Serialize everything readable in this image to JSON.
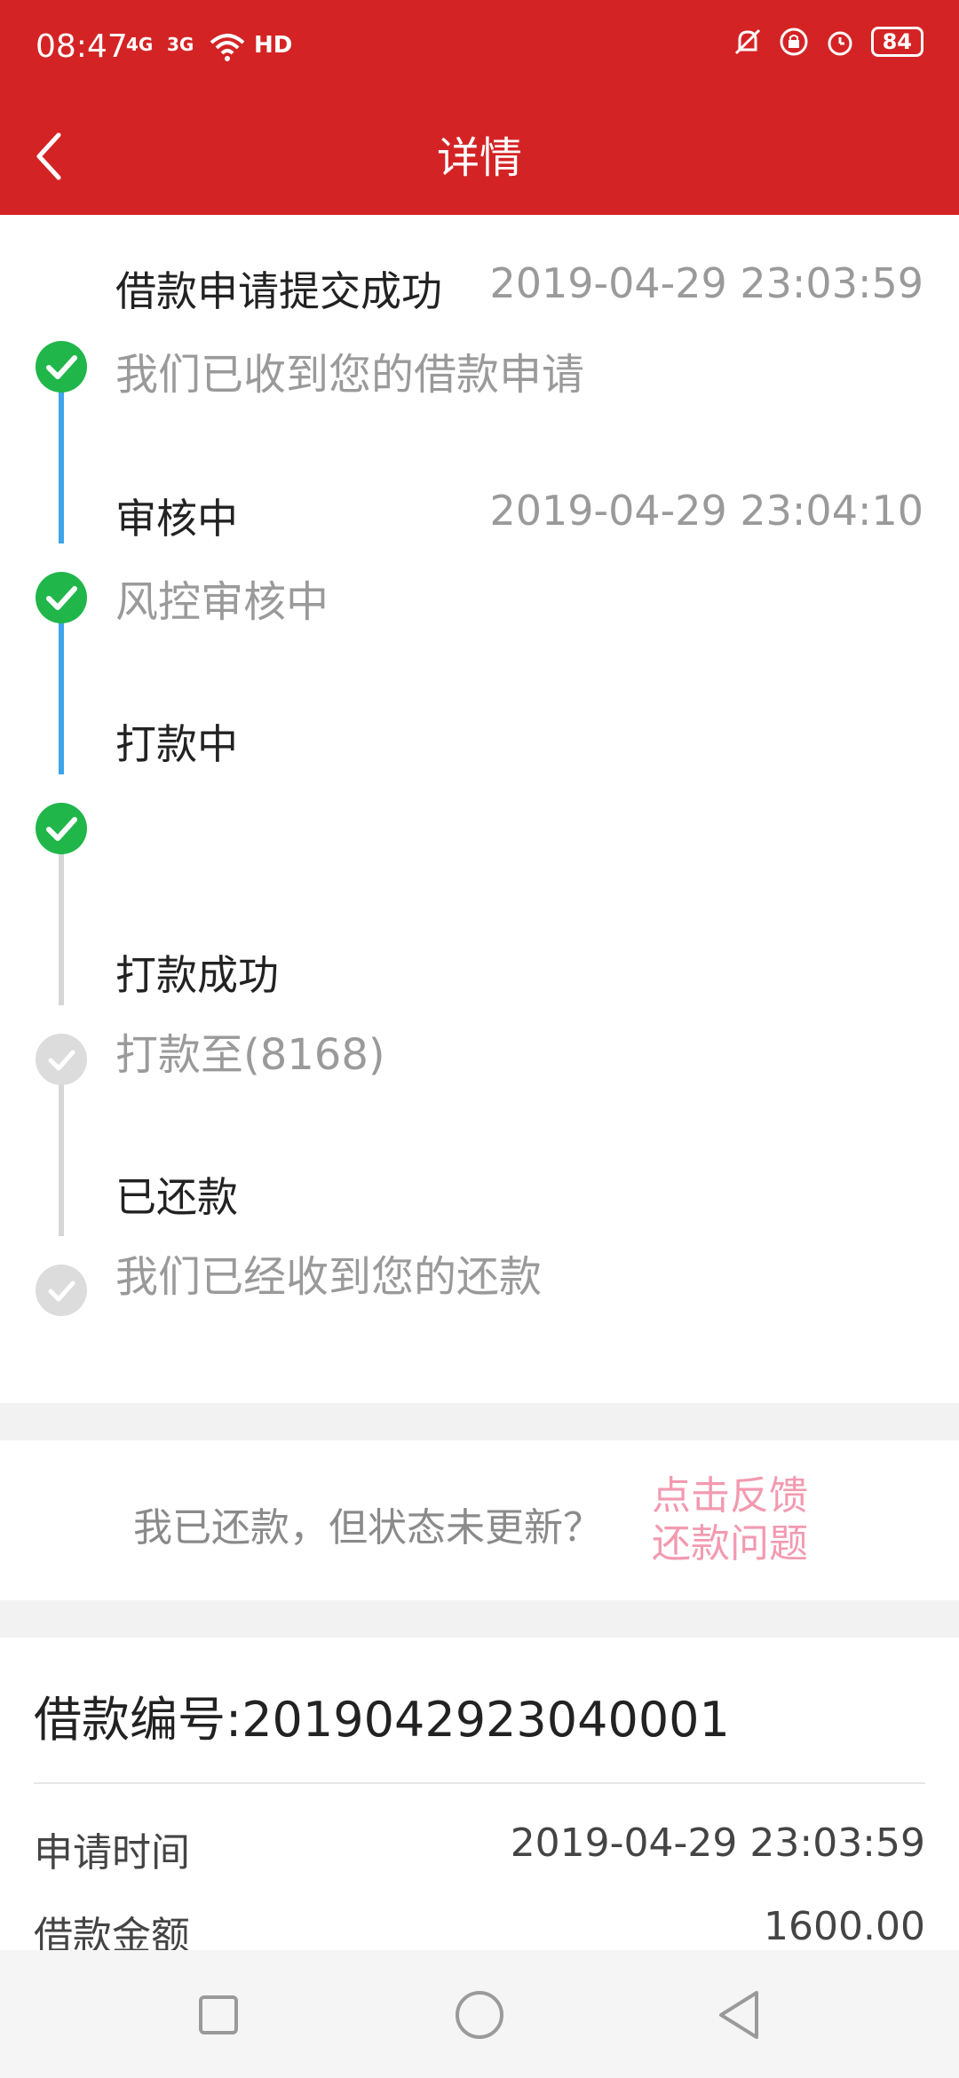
{
  "status_bar": {
    "time": "08:47",
    "sig1": "4G",
    "sig2": "3G",
    "hd": "HD",
    "battery": "84"
  },
  "header": {
    "title": "详情"
  },
  "timeline": {
    "steps": [
      {
        "title": "借款申请提交成功",
        "time": "2019-04-29 23:03:59",
        "desc": "我们已收到您的借款申请",
        "status": "done"
      },
      {
        "title": "审核中",
        "time": "2019-04-29 23:04:10",
        "desc": "风控审核中",
        "status": "done"
      },
      {
        "title": "打款中",
        "time": "",
        "desc": "",
        "status": "done"
      },
      {
        "title": "打款成功",
        "time": "",
        "desc": "打款至(8168)",
        "status": "pending"
      },
      {
        "title": "已还款",
        "time": "",
        "desc": "我们已经收到您的还款",
        "status": "pending"
      }
    ]
  },
  "feedback": {
    "text": "我已还款，但状态未更新？",
    "link_line1": "点击反馈",
    "link_line2": "还款问题"
  },
  "loan_info": {
    "loan_number": "借款编号:2019042923040001",
    "rows": [
      {
        "label": "申请时间",
        "value": "2019-04-29 23:03:59"
      },
      {
        "label": "借款金额",
        "value": "1600.00"
      }
    ]
  },
  "colors": {
    "accent": "#d42324",
    "done": "#20b64a",
    "pending": "#dcdcdc",
    "line_active": "#3fa4ea",
    "link": "#f39ab0"
  }
}
